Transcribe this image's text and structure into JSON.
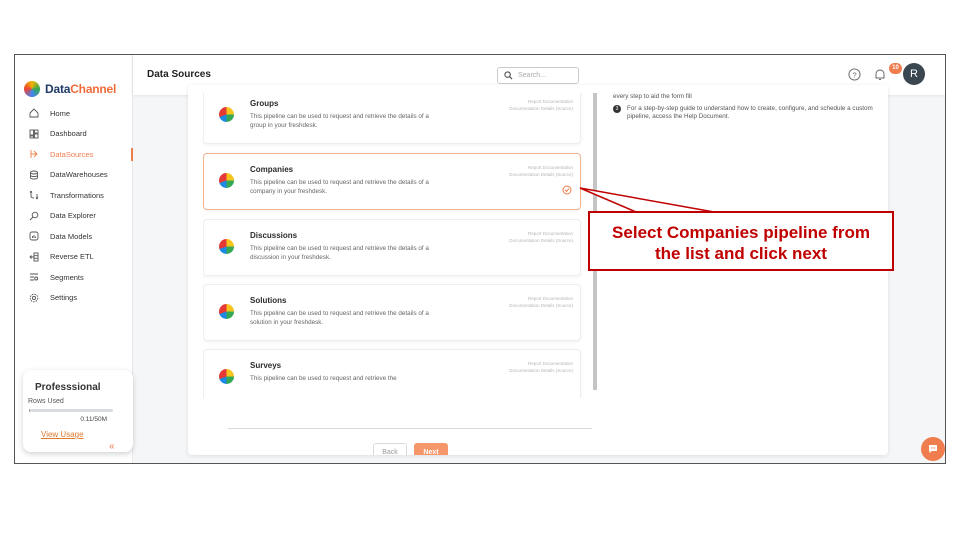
{
  "app": {
    "brand_a": "Data",
    "brand_b": "Channel"
  },
  "sidebar": {
    "items": [
      {
        "label": "Home",
        "icon": "home-icon"
      },
      {
        "label": "Dashboard",
        "icon": "dashboard-icon"
      },
      {
        "label": "DataSources",
        "icon": "datasources-icon",
        "active": true
      },
      {
        "label": "DataWarehouses",
        "icon": "database-icon"
      },
      {
        "label": "Transformations",
        "icon": "transform-icon"
      },
      {
        "label": "Data Explorer",
        "icon": "explorer-icon"
      },
      {
        "label": "Data Models",
        "icon": "models-icon"
      },
      {
        "label": "Reverse ETL",
        "icon": "reverse-etl-icon"
      },
      {
        "label": "Segments",
        "icon": "segments-icon"
      },
      {
        "label": "Settings",
        "icon": "settings-icon"
      }
    ],
    "plan": {
      "name": "Professsional",
      "rows_label": "Rows Used",
      "rows_value": "0.11/50M",
      "usage_fraction": 0.0022,
      "view_usage": "View Usage"
    },
    "collapse_glyph": "«"
  },
  "topbar": {
    "title": "Data Sources",
    "search_placeholder": "Search...",
    "notification_count": "10",
    "avatar_letter": "R"
  },
  "pipelines": [
    {
      "title": "Groups",
      "desc": "This pipeline can be used to request and retrieve the details of a group in your freshdesk.",
      "link1": "Report Documentation",
      "link2": "Documentation Details (Source)",
      "selected": false
    },
    {
      "title": "Companies",
      "desc": "This pipeline can be used to request and retrieve the details of a company in your freshdesk.",
      "link1": "Report Documentation",
      "link2": "Documentation Details (Source)",
      "selected": true
    },
    {
      "title": "Discussions",
      "desc": "This pipeline can be used to request and retrieve the details of a discussion in your freshdesk.",
      "link1": "Report Documentation",
      "link2": "Documentation Details (Source)",
      "selected": false
    },
    {
      "title": "Solutions",
      "desc": "This pipeline can be used to request and retrieve the details of a solution in your freshdesk.",
      "link1": "Report Documentation",
      "link2": "Documentation Details (Source)",
      "selected": false
    },
    {
      "title": "Surveys",
      "desc": "This pipeline can be used to request and retrieve the",
      "link1": "Report Documentation",
      "link2": "Documentation Details (Source)",
      "selected": false
    }
  ],
  "buttons": {
    "back": "Back",
    "next": "Next"
  },
  "help": {
    "line0": "every step to aid the form fill",
    "step_num": "3",
    "step_text": "For a step-by-step guide to understand how to create, configure, and schedule a custom pipeline, access the Help Document."
  },
  "callout": {
    "line1": "Select Companies pipeline from",
    "line2": "the list and click next"
  },
  "colors": {
    "accent": "#ef7d4e",
    "callout": "#c00000"
  }
}
